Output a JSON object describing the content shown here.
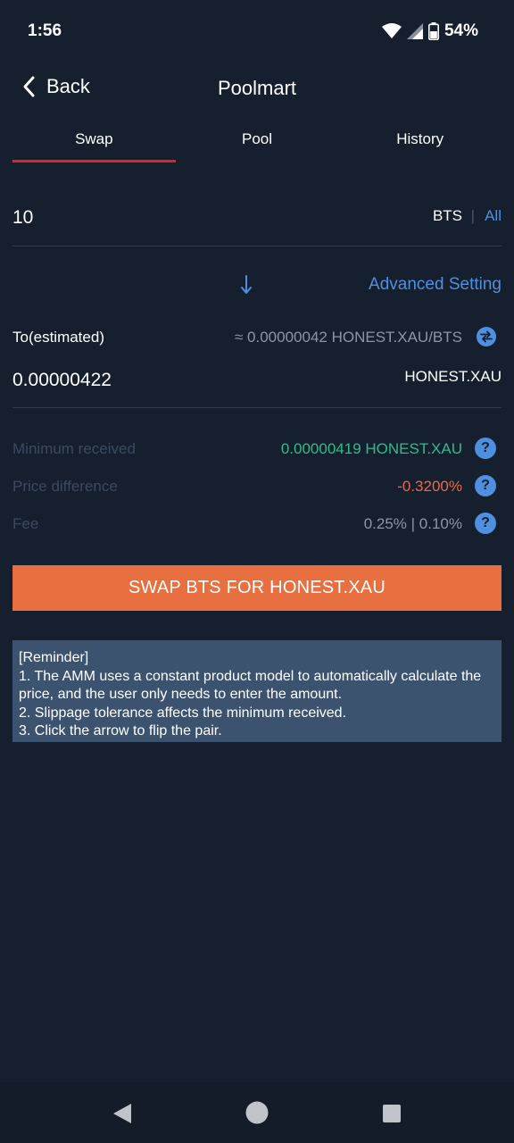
{
  "status_bar": {
    "time": "1:56",
    "battery": "54%",
    "icons": [
      "wifi-icon",
      "signal-icon",
      "battery-icon"
    ]
  },
  "header": {
    "back_label": "Back",
    "title": "Poolmart"
  },
  "tabs": [
    {
      "label": "Swap",
      "active": true
    },
    {
      "label": "Pool",
      "active": false
    },
    {
      "label": "History",
      "active": false
    }
  ],
  "swap": {
    "amount_value": "10",
    "from_asset": "BTS",
    "separator": "|",
    "all_label": "All",
    "advanced_label": "Advanced Setting",
    "to_label": "To(estimated)",
    "rate_text": "≈ 0.00000042 HONEST.XAU/BTS",
    "to_value": "0.00000422",
    "to_asset": "HONEST.XAU"
  },
  "info": {
    "min_received_label": "Minimum received",
    "min_received_value": "0.00000419 HONEST.XAU",
    "price_diff_label": "Price difference",
    "price_diff_value": "-0.3200%",
    "fee_label": "Fee",
    "fee_value": "0.25% | 0.10%",
    "help_symbol": "?"
  },
  "action": {
    "swap_button_label": "SWAP BTS FOR HONEST.XAU"
  },
  "reminder": {
    "lines": [
      "[Reminder]",
      "1. The AMM uses a constant product model to automatically calculate the price, and the user only needs to enter the amount.",
      "2. Slippage tolerance affects the minimum received.",
      "3. Click the arrow to flip the pair."
    ]
  },
  "colors": {
    "background": "#161f2e",
    "accent_blue": "#4f8fe0",
    "tab_indicator": "#e0222c",
    "swap_button": "#e87040",
    "positive_green": "#2dbd8b",
    "negative_red": "#e86a4a",
    "muted_label": "#3a4a61",
    "reminder_bg": "#3c5370"
  },
  "nav_bar": {
    "icons": [
      "back-triangle-icon",
      "home-circle-icon",
      "recents-square-icon"
    ]
  }
}
